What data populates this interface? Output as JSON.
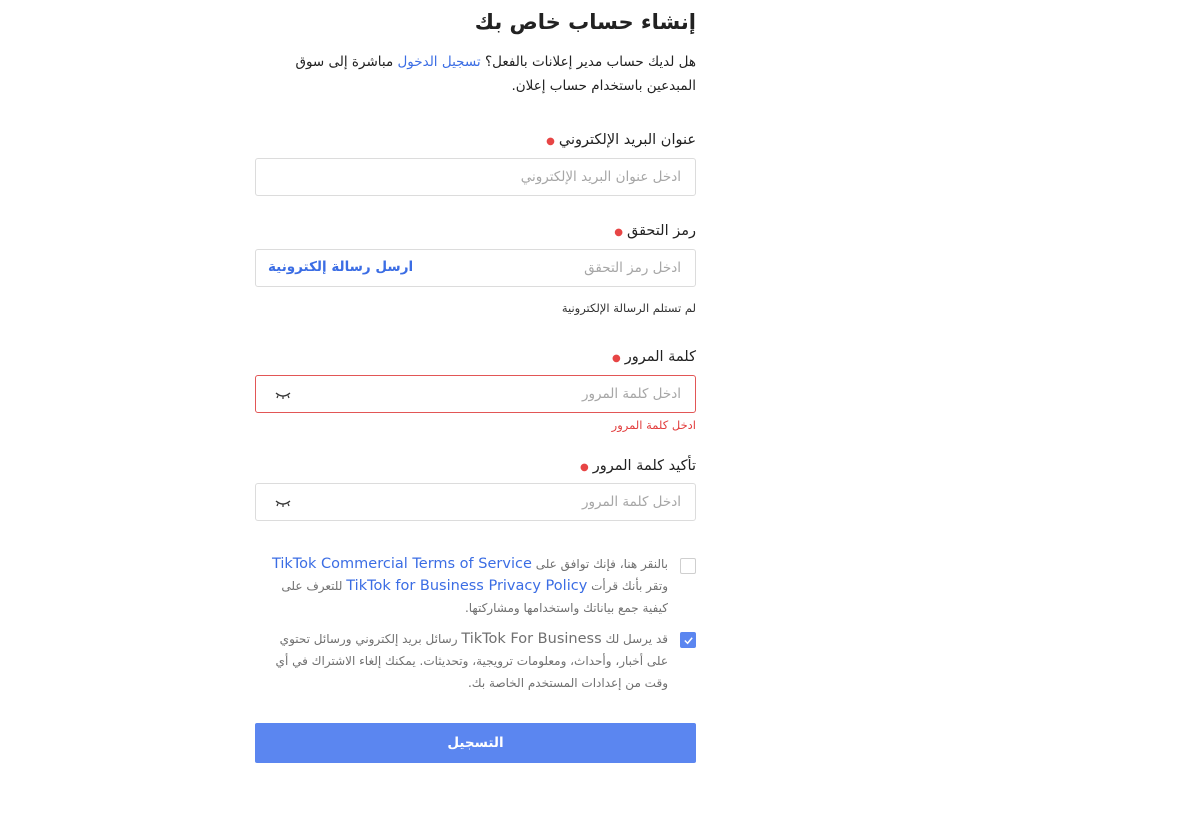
{
  "header": {
    "title": "إنشاء حساب خاص بك"
  },
  "intro": {
    "text_before": "هل لديك حساب مدير إعلانات بالفعل؟ ",
    "login_link": "تسجيل الدخول",
    "text_after": " مباشرة إلى سوق المبدعين باستخدام حساب إعلان."
  },
  "email": {
    "label": "عنوان البريد الإلكتروني",
    "placeholder": "ادخل عنوان البريد الإلكتروني",
    "value": ""
  },
  "code": {
    "label": "رمز التحقق",
    "placeholder": "ادخل رمز التحقق",
    "value": "",
    "send_label": "ارسل رسالة إلكترونية",
    "hint": "لم تستلم الرسالة الإلكترونية"
  },
  "password": {
    "label": "كلمة المرور",
    "placeholder": "ادخل كلمة المرور",
    "value": "",
    "error": "ادخل كلمة المرور"
  },
  "confirm_password": {
    "label": "تأكيد كلمة المرور",
    "placeholder": "ادخل كلمة المرور",
    "value": ""
  },
  "terms": {
    "checked": false,
    "text_1": "بالنقر هنا، فإنك توافق على ",
    "link_1": "TikTok Commercial Terms of Service",
    "text_2": " وتقر بأنك قرأت ",
    "link_2": "TikTok for Business Privacy Policy",
    "text_3": " للتعرف على كيفية جمع بياناتك واستخدامها ومشاركتها."
  },
  "marketing": {
    "checked": true,
    "text_1": "قد يرسل لك ",
    "brand": "TikTok For Business",
    "text_2": " رسائل بريد إلكتروني ورسائل تحتوي على أخبار، وأحداث، ومعلومات ترويجية، وتحديثات. يمكنك إلغاء الاشتراك في أي وقت من إعدادات المستخدم الخاصة بك."
  },
  "submit": {
    "label": "التسجيل"
  },
  "colors": {
    "accent": "#5b86f0",
    "link": "#3b6de4",
    "error": "#e23d3d",
    "required": "#e74545"
  }
}
